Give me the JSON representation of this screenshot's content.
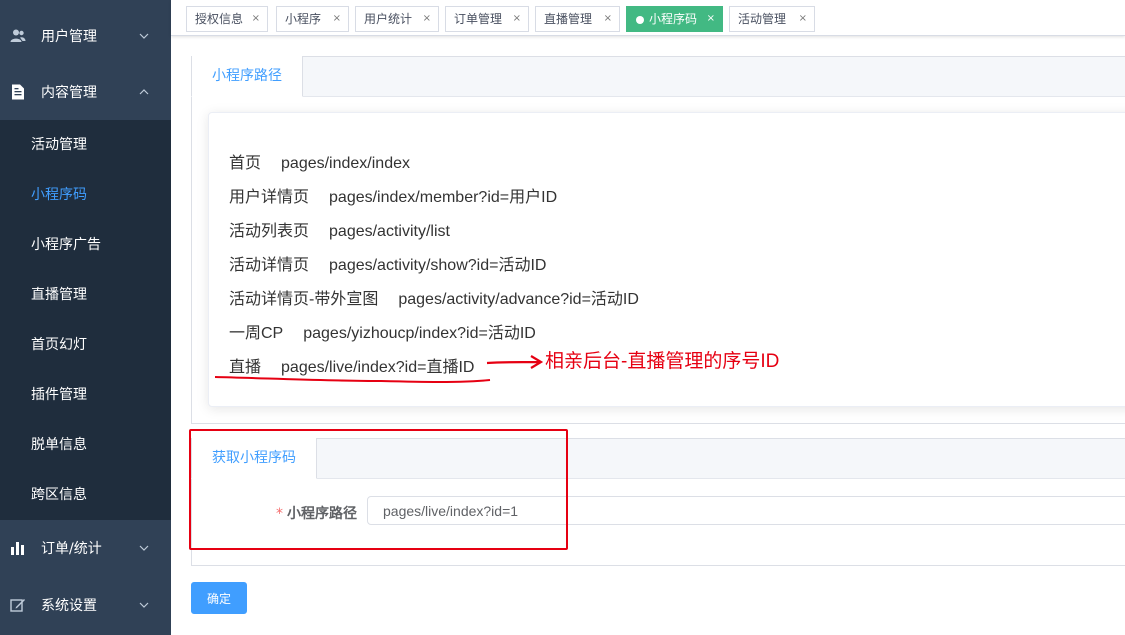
{
  "sidebar": {
    "groups": [
      {
        "label": "用户管理",
        "icon": "user-icon"
      },
      {
        "label": "内容管理",
        "icon": "document-icon"
      },
      {
        "label": "订单/统计",
        "icon": "bar-chart-icon"
      },
      {
        "label": "系统设置",
        "icon": "edit-icon"
      }
    ],
    "submenu": [
      {
        "label": "活动管理"
      },
      {
        "label": "小程序码",
        "active": true
      },
      {
        "label": "小程序广告"
      },
      {
        "label": "直播管理"
      },
      {
        "label": "首页幻灯"
      },
      {
        "label": "插件管理"
      },
      {
        "label": "脱单信息"
      },
      {
        "label": "跨区信息"
      }
    ],
    "colors": {
      "bg": "#304156",
      "submenu_bg": "#1f2d3d",
      "active": "#409eff"
    }
  },
  "tags": [
    {
      "label": "授权信息"
    },
    {
      "label": "小程序"
    },
    {
      "label": "用户统计"
    },
    {
      "label": "订单管理"
    },
    {
      "label": "直播管理"
    },
    {
      "label": "小程序码",
      "active": true
    },
    {
      "label": "活动管理"
    }
  ],
  "paths_card": {
    "tab_label": "小程序路径",
    "rows": [
      {
        "name": "首页",
        "path": "pages/index/index"
      },
      {
        "name": "用户详情页",
        "path": "pages/index/member?id=用户ID"
      },
      {
        "name": "活动列表页",
        "path": "pages/activity/list"
      },
      {
        "name": "活动详情页",
        "path": "pages/activity/show?id=活动ID"
      },
      {
        "name": "活动详情页-带外宣图",
        "path": "pages/activity/advance?id=活动ID"
      },
      {
        "name": "一周CP",
        "path": "pages/yizhoucp/index?id=活动ID"
      },
      {
        "name": "直播",
        "path": "pages/live/index?id=直播ID"
      }
    ],
    "annotation": "相亲后台-直播管理的序号ID"
  },
  "get_code_card": {
    "tab_label": "获取小程序码",
    "field_label": "小程序路径",
    "required_mark": "*",
    "field_value": "pages/live/index?id=1"
  },
  "confirm_button": "确定",
  "colors": {
    "accent": "#409eff",
    "tag_active": "#42b983",
    "annotation": "#e60012"
  }
}
